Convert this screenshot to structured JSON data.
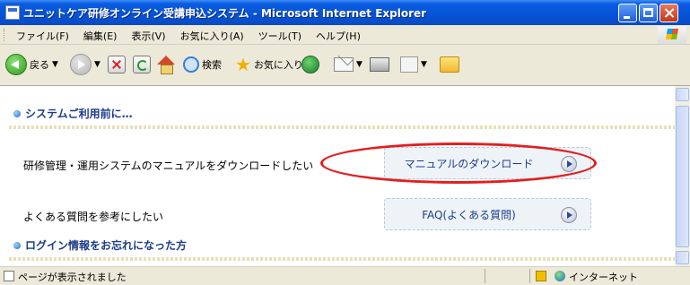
{
  "window": {
    "title": "ユニットケア研修オンライン受講申込システム - Microsoft Internet Explorer"
  },
  "menu": {
    "items": [
      "ファイル(F)",
      "編集(E)",
      "表示(V)",
      "お気に入り(A)",
      "ツール(T)",
      "ヘルプ(H)"
    ]
  },
  "toolbar": {
    "back_label": "戻る",
    "search_label": "検索",
    "favorites_label": "お気に入り"
  },
  "page": {
    "section1_title": "システムご利用前に…",
    "row1_text": "研修管理・運用システムのマニュアルをダウンロードしたい",
    "row1_button": "マニュアルのダウンロード",
    "row2_text": "よくある質問を参考にしたい",
    "row2_button": "FAQ(よくある質問)",
    "section2_title": "ログイン情報をお忘れになった方"
  },
  "status": {
    "text": "ページが表示されました",
    "zone": "インターネット"
  },
  "colors": {
    "highlight": "#e21f1f",
    "link_text": "#1c3c8c",
    "titlebar": "#0553d6"
  }
}
